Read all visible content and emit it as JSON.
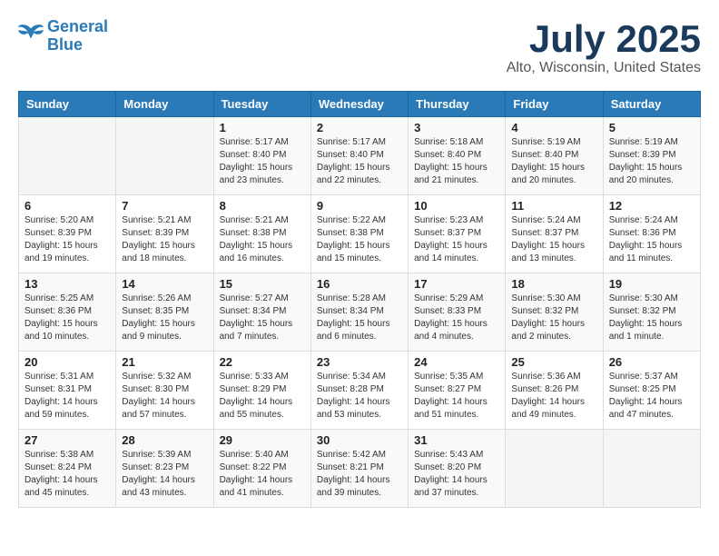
{
  "header": {
    "logo_line1": "General",
    "logo_line2": "Blue",
    "month": "July 2025",
    "location": "Alto, Wisconsin, United States"
  },
  "weekdays": [
    "Sunday",
    "Monday",
    "Tuesday",
    "Wednesday",
    "Thursday",
    "Friday",
    "Saturday"
  ],
  "weeks": [
    [
      {
        "day": "",
        "detail": ""
      },
      {
        "day": "",
        "detail": ""
      },
      {
        "day": "1",
        "detail": "Sunrise: 5:17 AM\nSunset: 8:40 PM\nDaylight: 15 hours\nand 23 minutes."
      },
      {
        "day": "2",
        "detail": "Sunrise: 5:17 AM\nSunset: 8:40 PM\nDaylight: 15 hours\nand 22 minutes."
      },
      {
        "day": "3",
        "detail": "Sunrise: 5:18 AM\nSunset: 8:40 PM\nDaylight: 15 hours\nand 21 minutes."
      },
      {
        "day": "4",
        "detail": "Sunrise: 5:19 AM\nSunset: 8:40 PM\nDaylight: 15 hours\nand 20 minutes."
      },
      {
        "day": "5",
        "detail": "Sunrise: 5:19 AM\nSunset: 8:39 PM\nDaylight: 15 hours\nand 20 minutes."
      }
    ],
    [
      {
        "day": "6",
        "detail": "Sunrise: 5:20 AM\nSunset: 8:39 PM\nDaylight: 15 hours\nand 19 minutes."
      },
      {
        "day": "7",
        "detail": "Sunrise: 5:21 AM\nSunset: 8:39 PM\nDaylight: 15 hours\nand 18 minutes."
      },
      {
        "day": "8",
        "detail": "Sunrise: 5:21 AM\nSunset: 8:38 PM\nDaylight: 15 hours\nand 16 minutes."
      },
      {
        "day": "9",
        "detail": "Sunrise: 5:22 AM\nSunset: 8:38 PM\nDaylight: 15 hours\nand 15 minutes."
      },
      {
        "day": "10",
        "detail": "Sunrise: 5:23 AM\nSunset: 8:37 PM\nDaylight: 15 hours\nand 14 minutes."
      },
      {
        "day": "11",
        "detail": "Sunrise: 5:24 AM\nSunset: 8:37 PM\nDaylight: 15 hours\nand 13 minutes."
      },
      {
        "day": "12",
        "detail": "Sunrise: 5:24 AM\nSunset: 8:36 PM\nDaylight: 15 hours\nand 11 minutes."
      }
    ],
    [
      {
        "day": "13",
        "detail": "Sunrise: 5:25 AM\nSunset: 8:36 PM\nDaylight: 15 hours\nand 10 minutes."
      },
      {
        "day": "14",
        "detail": "Sunrise: 5:26 AM\nSunset: 8:35 PM\nDaylight: 15 hours\nand 9 minutes."
      },
      {
        "day": "15",
        "detail": "Sunrise: 5:27 AM\nSunset: 8:34 PM\nDaylight: 15 hours\nand 7 minutes."
      },
      {
        "day": "16",
        "detail": "Sunrise: 5:28 AM\nSunset: 8:34 PM\nDaylight: 15 hours\nand 6 minutes."
      },
      {
        "day": "17",
        "detail": "Sunrise: 5:29 AM\nSunset: 8:33 PM\nDaylight: 15 hours\nand 4 minutes."
      },
      {
        "day": "18",
        "detail": "Sunrise: 5:30 AM\nSunset: 8:32 PM\nDaylight: 15 hours\nand 2 minutes."
      },
      {
        "day": "19",
        "detail": "Sunrise: 5:30 AM\nSunset: 8:32 PM\nDaylight: 15 hours\nand 1 minute."
      }
    ],
    [
      {
        "day": "20",
        "detail": "Sunrise: 5:31 AM\nSunset: 8:31 PM\nDaylight: 14 hours\nand 59 minutes."
      },
      {
        "day": "21",
        "detail": "Sunrise: 5:32 AM\nSunset: 8:30 PM\nDaylight: 14 hours\nand 57 minutes."
      },
      {
        "day": "22",
        "detail": "Sunrise: 5:33 AM\nSunset: 8:29 PM\nDaylight: 14 hours\nand 55 minutes."
      },
      {
        "day": "23",
        "detail": "Sunrise: 5:34 AM\nSunset: 8:28 PM\nDaylight: 14 hours\nand 53 minutes."
      },
      {
        "day": "24",
        "detail": "Sunrise: 5:35 AM\nSunset: 8:27 PM\nDaylight: 14 hours\nand 51 minutes."
      },
      {
        "day": "25",
        "detail": "Sunrise: 5:36 AM\nSunset: 8:26 PM\nDaylight: 14 hours\nand 49 minutes."
      },
      {
        "day": "26",
        "detail": "Sunrise: 5:37 AM\nSunset: 8:25 PM\nDaylight: 14 hours\nand 47 minutes."
      }
    ],
    [
      {
        "day": "27",
        "detail": "Sunrise: 5:38 AM\nSunset: 8:24 PM\nDaylight: 14 hours\nand 45 minutes."
      },
      {
        "day": "28",
        "detail": "Sunrise: 5:39 AM\nSunset: 8:23 PM\nDaylight: 14 hours\nand 43 minutes."
      },
      {
        "day": "29",
        "detail": "Sunrise: 5:40 AM\nSunset: 8:22 PM\nDaylight: 14 hours\nand 41 minutes."
      },
      {
        "day": "30",
        "detail": "Sunrise: 5:42 AM\nSunset: 8:21 PM\nDaylight: 14 hours\nand 39 minutes."
      },
      {
        "day": "31",
        "detail": "Sunrise: 5:43 AM\nSunset: 8:20 PM\nDaylight: 14 hours\nand 37 minutes."
      },
      {
        "day": "",
        "detail": ""
      },
      {
        "day": "",
        "detail": ""
      }
    ]
  ]
}
